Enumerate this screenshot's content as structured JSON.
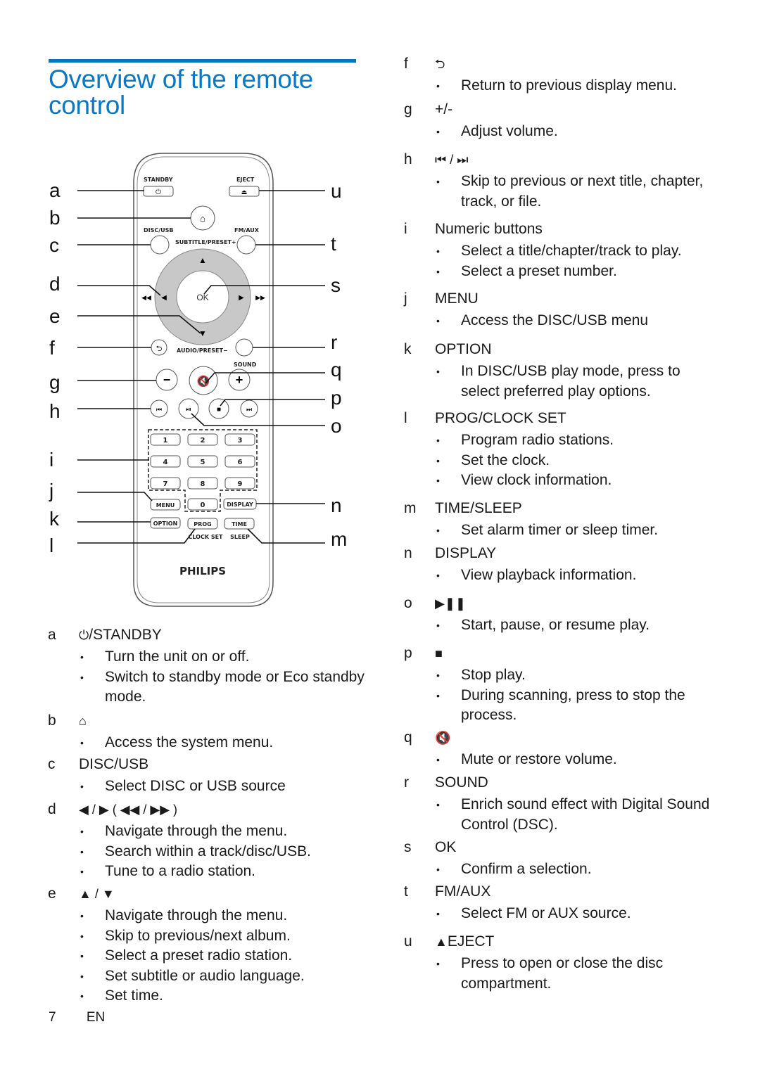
{
  "page": {
    "title": "Overview of the remote control",
    "title_color": "#0a78c2",
    "footer": {
      "page_number": "7",
      "language": "EN"
    }
  },
  "remote": {
    "brand": "PHILIPS",
    "labels": {
      "standby": "STANDBY",
      "eject": "EJECT",
      "disc_usb": "DISC/USB",
      "fm_aux": "FM/AUX",
      "subtitle_preset": "SUBTITLE/PRESET+",
      "ok": "OK",
      "audio_preset": "AUDIO/PRESET−",
      "sound": "SOUND",
      "menu": "MENU",
      "display": "DISPLAY",
      "option": "OPTION",
      "prog": "PROG",
      "time": "TIME",
      "clock_set": "CLOCK SET",
      "sleep": "SLEEP"
    },
    "numeric_keys": [
      "1",
      "2",
      "3",
      "4",
      "5",
      "6",
      "7",
      "8",
      "9",
      "0"
    ],
    "callouts_left": [
      "a",
      "b",
      "c",
      "d",
      "e",
      "f",
      "g",
      "h",
      "i",
      "j",
      "k",
      "l"
    ],
    "callouts_right": [
      "u",
      "t",
      "s",
      "r",
      "q",
      "p",
      "o",
      "n",
      "m"
    ]
  },
  "left_entries": [
    {
      "letter": "a",
      "icon": "power-icon",
      "symbol": "⏻",
      "head": "/STANDBY",
      "bullets": [
        "Turn the unit on or off.",
        "Switch to standby mode or Eco standby mode."
      ]
    },
    {
      "letter": "b",
      "icon": "home-icon",
      "symbol": "⌂",
      "head": "",
      "bullets": [
        "Access the system menu."
      ]
    },
    {
      "letter": "c",
      "icon": "",
      "symbol": "",
      "head": "DISC/USB",
      "bullets": [
        "Select DISC or USB source"
      ]
    },
    {
      "letter": "d",
      "icon": "left-right-arrows-icon",
      "symbol": "◀ / ▶ ( ◀◀ / ▶▶ )",
      "head": "",
      "bullets": [
        "Navigate through the menu.",
        "Search within a track/disc/USB.",
        "Tune to a radio station."
      ]
    },
    {
      "letter": "e",
      "icon": "up-down-arrows-icon",
      "symbol": "▲ / ▼",
      "head": "",
      "bullets": [
        "Navigate through the menu.",
        "Skip to previous/next album.",
        "Select a preset radio station.",
        "Set subtitle or audio language.",
        "Set time."
      ]
    }
  ],
  "right_entries": [
    {
      "letter": "f",
      "icon": "back-icon",
      "symbol": "⮌",
      "head": "",
      "bullets": [
        "Return to previous display menu."
      ]
    },
    {
      "letter": "g",
      "icon": "",
      "symbol": "",
      "head": "+/-",
      "bullets": [
        "Adjust volume."
      ]
    },
    {
      "letter": "h",
      "icon": "skip-prev-next-icon",
      "symbol": "⏮ / ⏭",
      "head": "",
      "bullets": [
        "Skip to previous or next title, chapter, track, or file."
      ]
    },
    {
      "letter": "i",
      "icon": "",
      "symbol": "",
      "head": "Numeric buttons",
      "bullets": [
        "Select a title/chapter/track to play.",
        "Select a preset number."
      ]
    },
    {
      "letter": "j",
      "icon": "",
      "symbol": "",
      "head": "MENU",
      "bullets": [
        "Access the DISC/USB menu"
      ]
    },
    {
      "letter": "k",
      "icon": "",
      "symbol": "",
      "head": "OPTION",
      "bullets": [
        "In DISC/USB play mode, press to select preferred play options."
      ]
    },
    {
      "letter": "l",
      "icon": "",
      "symbol": "",
      "head": "PROG/CLOCK SET",
      "bullets": [
        "Program radio stations.",
        "Set the clock.",
        "View clock information."
      ]
    },
    {
      "letter": "m",
      "icon": "",
      "symbol": "",
      "head": "TIME/SLEEP",
      "bullets": [
        "Set alarm timer or sleep timer."
      ]
    },
    {
      "letter": "n",
      "icon": "",
      "symbol": "",
      "head": "DISPLAY",
      "bullets": [
        "View playback information."
      ]
    },
    {
      "letter": "o",
      "icon": "play-pause-icon",
      "symbol": "▶❚❚",
      "head": "",
      "bullets": [
        "Start, pause, or resume play."
      ]
    },
    {
      "letter": "p",
      "icon": "stop-icon",
      "symbol": "■",
      "head": "",
      "bullets": [
        "Stop play.",
        "During scanning, press to stop the process."
      ]
    },
    {
      "letter": "q",
      "icon": "mute-icon",
      "symbol": "🔇",
      "head": "",
      "bullets": [
        "Mute or restore volume."
      ]
    },
    {
      "letter": "r",
      "icon": "",
      "symbol": "",
      "head": "SOUND",
      "bullets": [
        "Enrich sound effect with Digital Sound Control (DSC)."
      ]
    },
    {
      "letter": "s",
      "icon": "",
      "symbol": "",
      "head": "OK",
      "bullets": [
        "Confirm a selection."
      ]
    },
    {
      "letter": "t",
      "icon": "",
      "symbol": "",
      "head": "FM/AUX",
      "bullets": [
        "Select FM or AUX source."
      ]
    },
    {
      "letter": "u",
      "icon": "",
      "symbol": "▲",
      "head": "EJECT",
      "bullets": [
        "Press to open or close the disc compartment."
      ]
    }
  ]
}
